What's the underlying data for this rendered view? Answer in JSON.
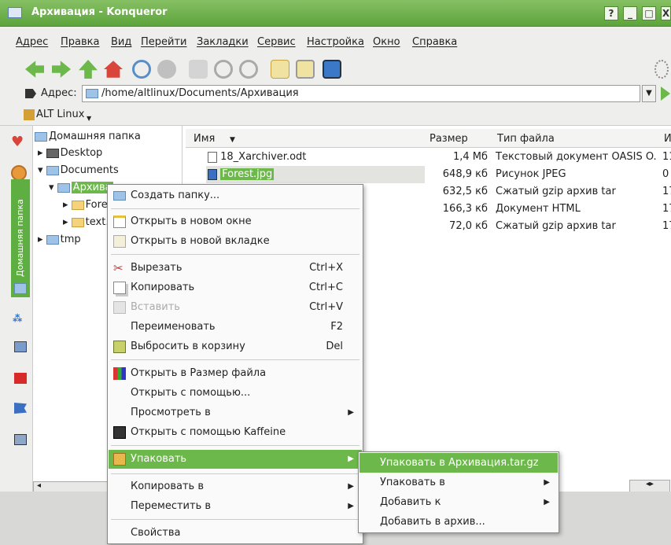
{
  "window": {
    "title": "Архивация - Konqueror",
    "buttons": [
      "?",
      "_",
      "□",
      "X"
    ]
  },
  "menubar": [
    "Адрес",
    "Правка",
    "Вид",
    "Перейти",
    "Закладки",
    "Сервис",
    "Настройка",
    "Окно",
    "Справка"
  ],
  "address": {
    "label": "Адрес:",
    "value": "/home/altlinux/Documents/Архивация"
  },
  "bookmarks": {
    "item": "ALT Linux"
  },
  "sidebar": {
    "tab": "Домашняя папка"
  },
  "tree": {
    "root": "Домашняя папка",
    "items": [
      "Desktop",
      "Documents",
      "Архива",
      "Fore",
      "text.",
      "tmp"
    ]
  },
  "files": {
    "headers": {
      "name": "Имя",
      "size": "Размер",
      "type": "Тип файла",
      "extra": "И"
    },
    "rows": [
      {
        "name": "18_Xarchiver.odt",
        "size": "1,4 Мб",
        "type": "Текстовый документ OASIS O...",
        "extra": "11"
      },
      {
        "name": "Forest.jpg",
        "size": "648,9 кб",
        "type": "Рисунок JPEG",
        "extra": "0"
      },
      {
        "name": "",
        "size": "632,5 кб",
        "type": "Сжатый gzip архив tar",
        "extra": "17"
      },
      {
        "name": "",
        "size": "166,3 кб",
        "type": "Документ HTML",
        "extra": "17"
      },
      {
        "name": "",
        "size": "72,0 кб",
        "type": "Сжатый gzip архив tar",
        "extra": "17"
      }
    ]
  },
  "context_menu": {
    "items": [
      {
        "label": "Создать папку...",
        "icon": "folder-icon"
      },
      {
        "label": "Открыть в новом окне",
        "icon": "window-icon"
      },
      {
        "label": "Открыть в новой вкладке",
        "icon": "tab-icon"
      },
      {
        "label": "Вырезать",
        "shortcut": "Ctrl+X",
        "icon": "scissors-icon"
      },
      {
        "label": "Копировать",
        "shortcut": "Ctrl+C",
        "icon": "copy-icon"
      },
      {
        "label": "Вставить",
        "shortcut": "Ctrl+V",
        "icon": "paste-icon",
        "disabled": true
      },
      {
        "label": "Переименовать",
        "shortcut": "F2"
      },
      {
        "label": "Выбросить в корзину",
        "shortcut": "Del",
        "icon": "trash-icon"
      },
      {
        "label": "Открыть в Размер файла",
        "icon": "filelight-icon"
      },
      {
        "label": "Открыть с помощью..."
      },
      {
        "label": "Просмотреть в",
        "submenu": true
      },
      {
        "label": "Открыть с помощью Kaffeine",
        "icon": "kaffeine-icon"
      },
      {
        "label": "Упаковать",
        "submenu": true,
        "icon": "archive-icon",
        "highlighted": true
      },
      {
        "label": "Копировать в",
        "submenu": true
      },
      {
        "label": "Переместить в",
        "submenu": true
      },
      {
        "label": "Свойства"
      }
    ]
  },
  "submenu": {
    "items": [
      {
        "label": "Упаковать в Архивация.tar.gz",
        "highlighted": true
      },
      {
        "label": "Упаковать в",
        "submenu": true
      },
      {
        "label": "Добавить к",
        "submenu": true
      },
      {
        "label": "Добавить в архив..."
      }
    ]
  },
  "colors": {
    "accent": "#6cb84a",
    "titlebar": "#5da43c"
  }
}
